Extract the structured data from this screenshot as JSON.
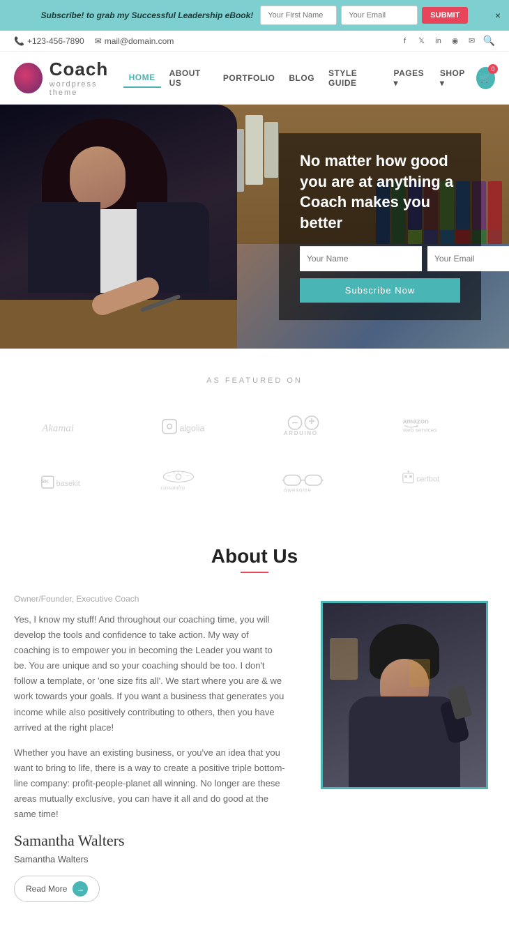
{
  "banner": {
    "text": "Subscribe! to grab my Successful Leadership",
    "text_italic": "eBook!",
    "input1_placeholder": "Your First Name",
    "input2_placeholder": "Your Email",
    "submit_label": "SUBMIT",
    "close_icon": "×"
  },
  "topbar": {
    "phone": "+123-456-7890",
    "email": "mail@domain.com",
    "phone_icon": "📞",
    "email_icon": "✉",
    "socials": [
      "f",
      "t",
      "in",
      "📷",
      "✉"
    ]
  },
  "header": {
    "logo_title": "Coach",
    "logo_subtitle": "WordPress theme",
    "nav": [
      {
        "label": "HOME",
        "active": true
      },
      {
        "label": "ABOUT US",
        "active": false
      },
      {
        "label": "PORTFOLIO",
        "active": false
      },
      {
        "label": "BLOG",
        "active": false
      },
      {
        "label": "STYLE GUIDE",
        "active": false
      },
      {
        "label": "PAGES",
        "active": false,
        "dropdown": true
      },
      {
        "label": "SHOP",
        "active": false,
        "dropdown": true
      }
    ],
    "cart_count": "0"
  },
  "hero": {
    "title": "No matter how good you are at anything a Coach makes you better",
    "name_placeholder": "Your Name",
    "email_placeholder": "Your Email",
    "subscribe_label": "Subscribe Now"
  },
  "featured": {
    "label": "AS FEATURED ON",
    "logos": [
      "Akamai",
      "algolia",
      "ARDUINO",
      "amazon web services",
      "basekit",
      "cassandra",
      "awesome",
      "certbot"
    ]
  },
  "about": {
    "title": "About Us",
    "subtitle": "Owner/Founder, Executive Coach",
    "para1": "Yes, I know my stuff! And throughout our coaching time, you will develop the tools and confidence to take action. My way of coaching is to empower you in becoming the Leader you want to be. You are unique and so your coaching should be too. I don't follow a template, or 'one size fits all'. We start where you are & we work towards your goals. If you want a business that generates you income while also positively contributing to others, then you have arrived at the right place!",
    "para2": "Whether you have an existing business, or you've an idea that you want to bring to life, there is a way to create a positive triple bottom-line company: profit-people-planet all winning. No longer are these areas mutually exclusive, you can have it all and do good at the same time!",
    "signature": "Samantha Walters",
    "name": "Samantha Walters",
    "read_more_label": "Read More"
  },
  "binder_colors": [
    "#2a2a4a",
    "#3a6a3a",
    "#4a8a4a",
    "#6ab06a",
    "#4a4a8a",
    "#2a5a9a",
    "#9a2a2a",
    "#c03030"
  ]
}
